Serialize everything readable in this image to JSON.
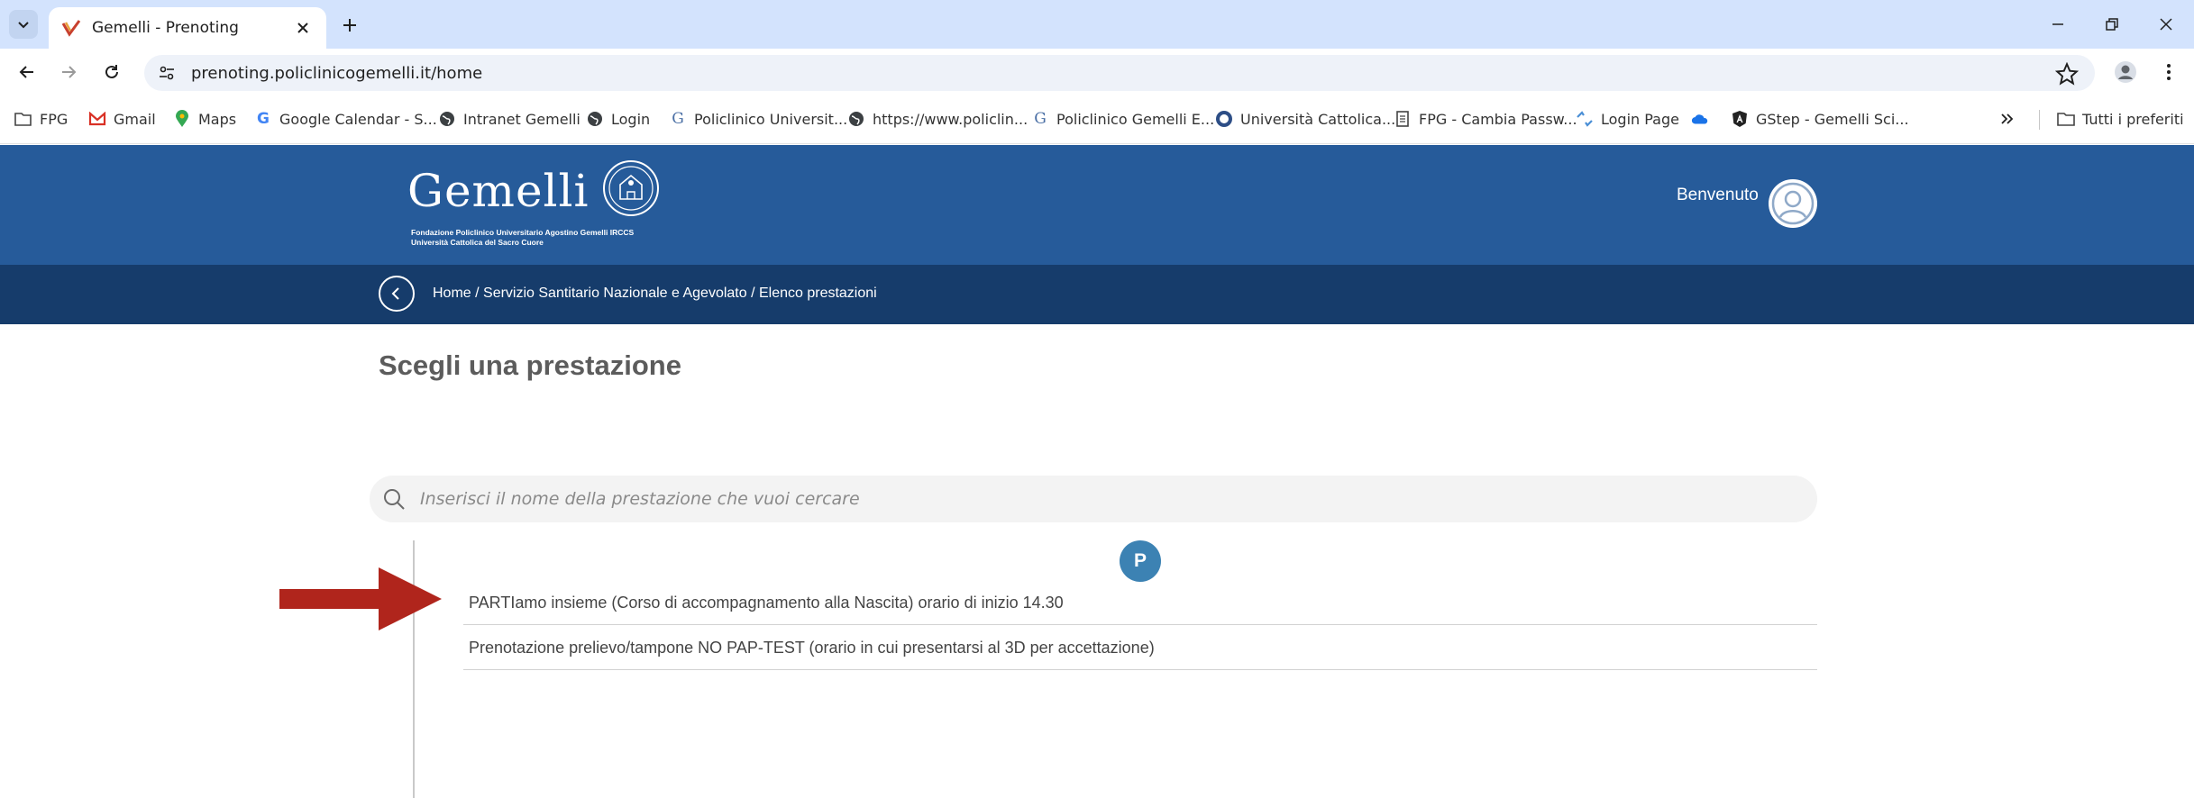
{
  "browser": {
    "tab_title": "Gemelli - Prenoting",
    "url": "prenoting.policlinicogemelli.it/home",
    "bookmarks": [
      {
        "label": "FPG",
        "icon": "folder-gear-icon"
      },
      {
        "label": "Gmail",
        "icon": "gmail-icon"
      },
      {
        "label": "Maps",
        "icon": "maps-pin-icon"
      },
      {
        "label": "Google Calendar - S...",
        "icon": "google-g-icon"
      },
      {
        "label": "Intranet Gemelli",
        "icon": "globe-icon"
      },
      {
        "label": "Login",
        "icon": "globe-icon"
      },
      {
        "label": "Policlinico Universit...",
        "icon": "gemelli-g-icon"
      },
      {
        "label": "https://www.policlin...",
        "icon": "globe-icon"
      },
      {
        "label": "Policlinico Gemelli E...",
        "icon": "gemelli-g-icon"
      },
      {
        "label": "Università Cattolica...",
        "icon": "university-seal-icon"
      },
      {
        "label": "FPG - Cambia Passw...",
        "icon": "page-icon"
      },
      {
        "label": "Login Page",
        "icon": "sync-icon"
      },
      {
        "label": "",
        "icon": "cloud-icon"
      },
      {
        "label": "GStep - Gemelli Sci...",
        "icon": "angular-icon"
      }
    ],
    "all_bookmarks_label": "Tutti i preferiti"
  },
  "header": {
    "logo_text": "Gemelli",
    "logo_line1": "Fondazione Policlinico Universitario Agostino Gemelli IRCCS",
    "logo_line2": "Università Cattolica del Sacro Cuore",
    "welcome": "Benvenuto"
  },
  "breadcrumb": "Home / Servizio Santitario Nazionale e Agevolato / Elenco prestazioni",
  "main": {
    "title": "Scegli una prestazione",
    "search_placeholder": "Inserisci il nome della prestazione che vuoi cercare",
    "letter": "P",
    "items": [
      "PARTIamo insieme (Corso di accompagnamento alla Nascita) orario di inizio 14.30",
      "Prenotazione prelievo/tampone NO PAP-TEST (orario in cui presentarsi al 3D per accettazione)"
    ]
  },
  "colors": {
    "header_blue": "#265b9a",
    "breadbar_blue": "#163c6b",
    "badge_blue": "#3c82b3",
    "arrow_red": "#b0251c"
  }
}
